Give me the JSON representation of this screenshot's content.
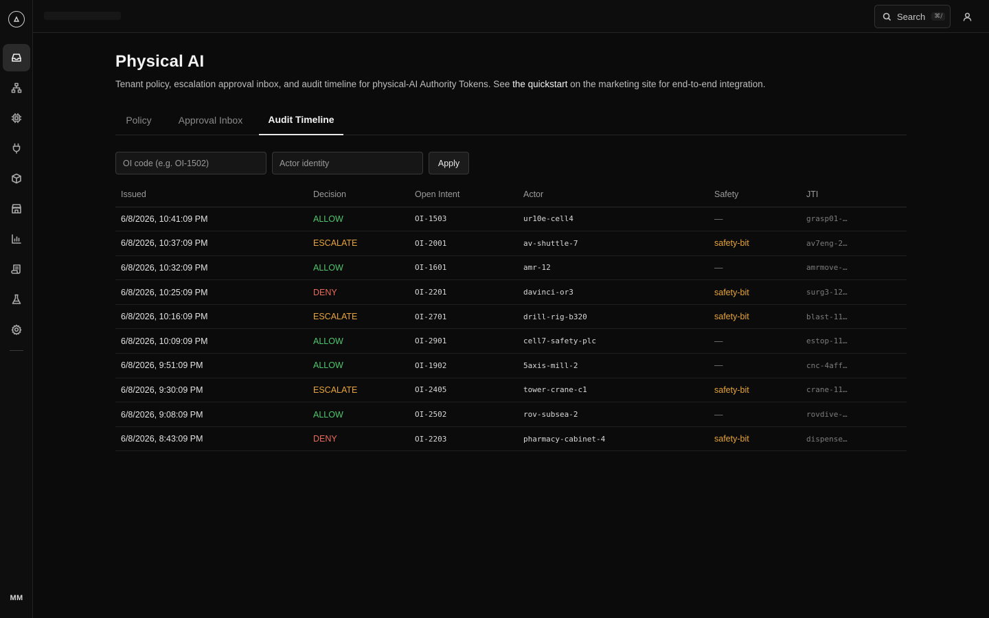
{
  "rail": {
    "items": [
      "inbox-icon",
      "hierarchy-icon",
      "chip-icon",
      "plug-icon",
      "cube-icon",
      "store-icon",
      "bar-chart-icon",
      "scroll-icon",
      "flask-icon",
      "gear-icon"
    ],
    "avatar": "MM"
  },
  "topbar": {
    "search_label": "Search",
    "search_shortcut": "⌘/"
  },
  "page": {
    "title": "Physical AI",
    "desc_before": "Tenant policy, escalation approval inbox, and audit timeline for physical-AI Authority Tokens. See ",
    "desc_link": "the quickstart",
    "desc_after": " on the marketing site for end-to-end integration."
  },
  "tabs": [
    {
      "label": "Policy",
      "active": false
    },
    {
      "label": "Approval Inbox",
      "active": false
    },
    {
      "label": "Audit Timeline",
      "active": true
    }
  ],
  "filters": {
    "oi_placeholder": "OI code (e.g. OI-1502)",
    "actor_placeholder": "Actor identity",
    "apply_label": "Apply"
  },
  "table": {
    "columns": [
      "Issued",
      "Decision",
      "Open Intent",
      "Actor",
      "Safety",
      "JTI"
    ],
    "rows": [
      {
        "issued": "6/8/2026, 10:41:09 PM",
        "decision": "ALLOW",
        "intent": "OI-1503",
        "actor": "ur10e-cell4",
        "safety": "—",
        "jti": "grasp01-…"
      },
      {
        "issued": "6/8/2026, 10:37:09 PM",
        "decision": "ESCALATE",
        "intent": "OI-2001",
        "actor": "av-shuttle-7",
        "safety": "safety-bit",
        "jti": "av7eng-2…"
      },
      {
        "issued": "6/8/2026, 10:32:09 PM",
        "decision": "ALLOW",
        "intent": "OI-1601",
        "actor": "amr-12",
        "safety": "—",
        "jti": "amrmove-…"
      },
      {
        "issued": "6/8/2026, 10:25:09 PM",
        "decision": "DENY",
        "intent": "OI-2201",
        "actor": "davinci-or3",
        "safety": "safety-bit",
        "jti": "surg3-12…"
      },
      {
        "issued": "6/8/2026, 10:16:09 PM",
        "decision": "ESCALATE",
        "intent": "OI-2701",
        "actor": "drill-rig-b320",
        "safety": "safety-bit",
        "jti": "blast-11…"
      },
      {
        "issued": "6/8/2026, 10:09:09 PM",
        "decision": "ALLOW",
        "intent": "OI-2901",
        "actor": "cell7-safety-plc",
        "safety": "—",
        "jti": "estop-11…"
      },
      {
        "issued": "6/8/2026, 9:51:09 PM",
        "decision": "ALLOW",
        "intent": "OI-1902",
        "actor": "5axis-mill-2",
        "safety": "—",
        "jti": "cnc-4aff…"
      },
      {
        "issued": "6/8/2026, 9:30:09 PM",
        "decision": "ESCALATE",
        "intent": "OI-2405",
        "actor": "tower-crane-c1",
        "safety": "safety-bit",
        "jti": "crane-11…"
      },
      {
        "issued": "6/8/2026, 9:08:09 PM",
        "decision": "ALLOW",
        "intent": "OI-2502",
        "actor": "rov-subsea-2",
        "safety": "—",
        "jti": "rovdive-…"
      },
      {
        "issued": "6/8/2026, 8:43:09 PM",
        "decision": "DENY",
        "intent": "OI-2203",
        "actor": "pharmacy-cabinet-4",
        "safety": "safety-bit",
        "jti": "dispense…"
      }
    ]
  },
  "colors": {
    "allow": "#4fc76e",
    "escalate": "#e8a53a",
    "deny": "#e86c5a",
    "background": "#0b0b0b"
  }
}
